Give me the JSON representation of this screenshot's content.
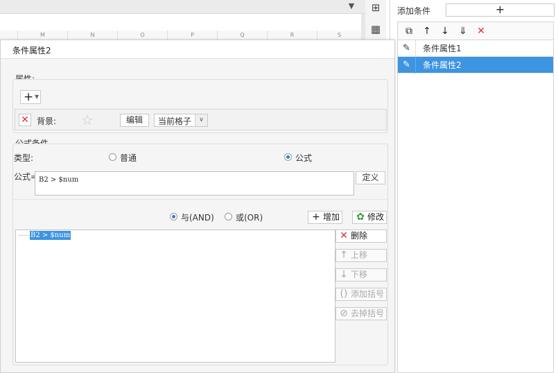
{
  "spreadsheet": {
    "columns": [
      "M",
      "N",
      "O",
      "P",
      "Q",
      "R",
      "S"
    ]
  },
  "condition_panel": {
    "add_condition_label": "添加条件",
    "add_button": "+",
    "items": [
      {
        "label": "条件属性1",
        "selected": false
      },
      {
        "label": "条件属性2",
        "selected": true
      }
    ]
  },
  "dialog": {
    "title": "条件属性2",
    "attributes": {
      "label": "属性:",
      "add_button": "+",
      "background": {
        "label": "背景:",
        "edit_button": "编辑",
        "scope_value": "当前格子"
      }
    },
    "formula_condition": {
      "label": "公式条件",
      "type_label": "类型:",
      "type_options": [
        {
          "label": "普通",
          "selected": false
        },
        {
          "label": "公式",
          "selected": true
        }
      ],
      "formula_label": "公式=",
      "formula_value": "B2 > $num",
      "define_button": "定义",
      "logic_options": [
        {
          "label": "与(AND)",
          "selected": true
        },
        {
          "label": "或(OR)",
          "selected": false
        }
      ],
      "add_button": "增加",
      "modify_button": "修改",
      "expressions": [
        "B2 > $num"
      ],
      "side_buttons": [
        {
          "label": "删除",
          "enabled": true
        },
        {
          "label": "上移",
          "enabled": false
        },
        {
          "label": "下移",
          "enabled": false
        },
        {
          "label": "添加括号",
          "enabled": false
        },
        {
          "label": "去掉括号",
          "enabled": false
        }
      ]
    }
  },
  "colors": {
    "selection": "#3d94e0",
    "delete_red": "#e03030",
    "radio_on": "#3a7bd5"
  }
}
